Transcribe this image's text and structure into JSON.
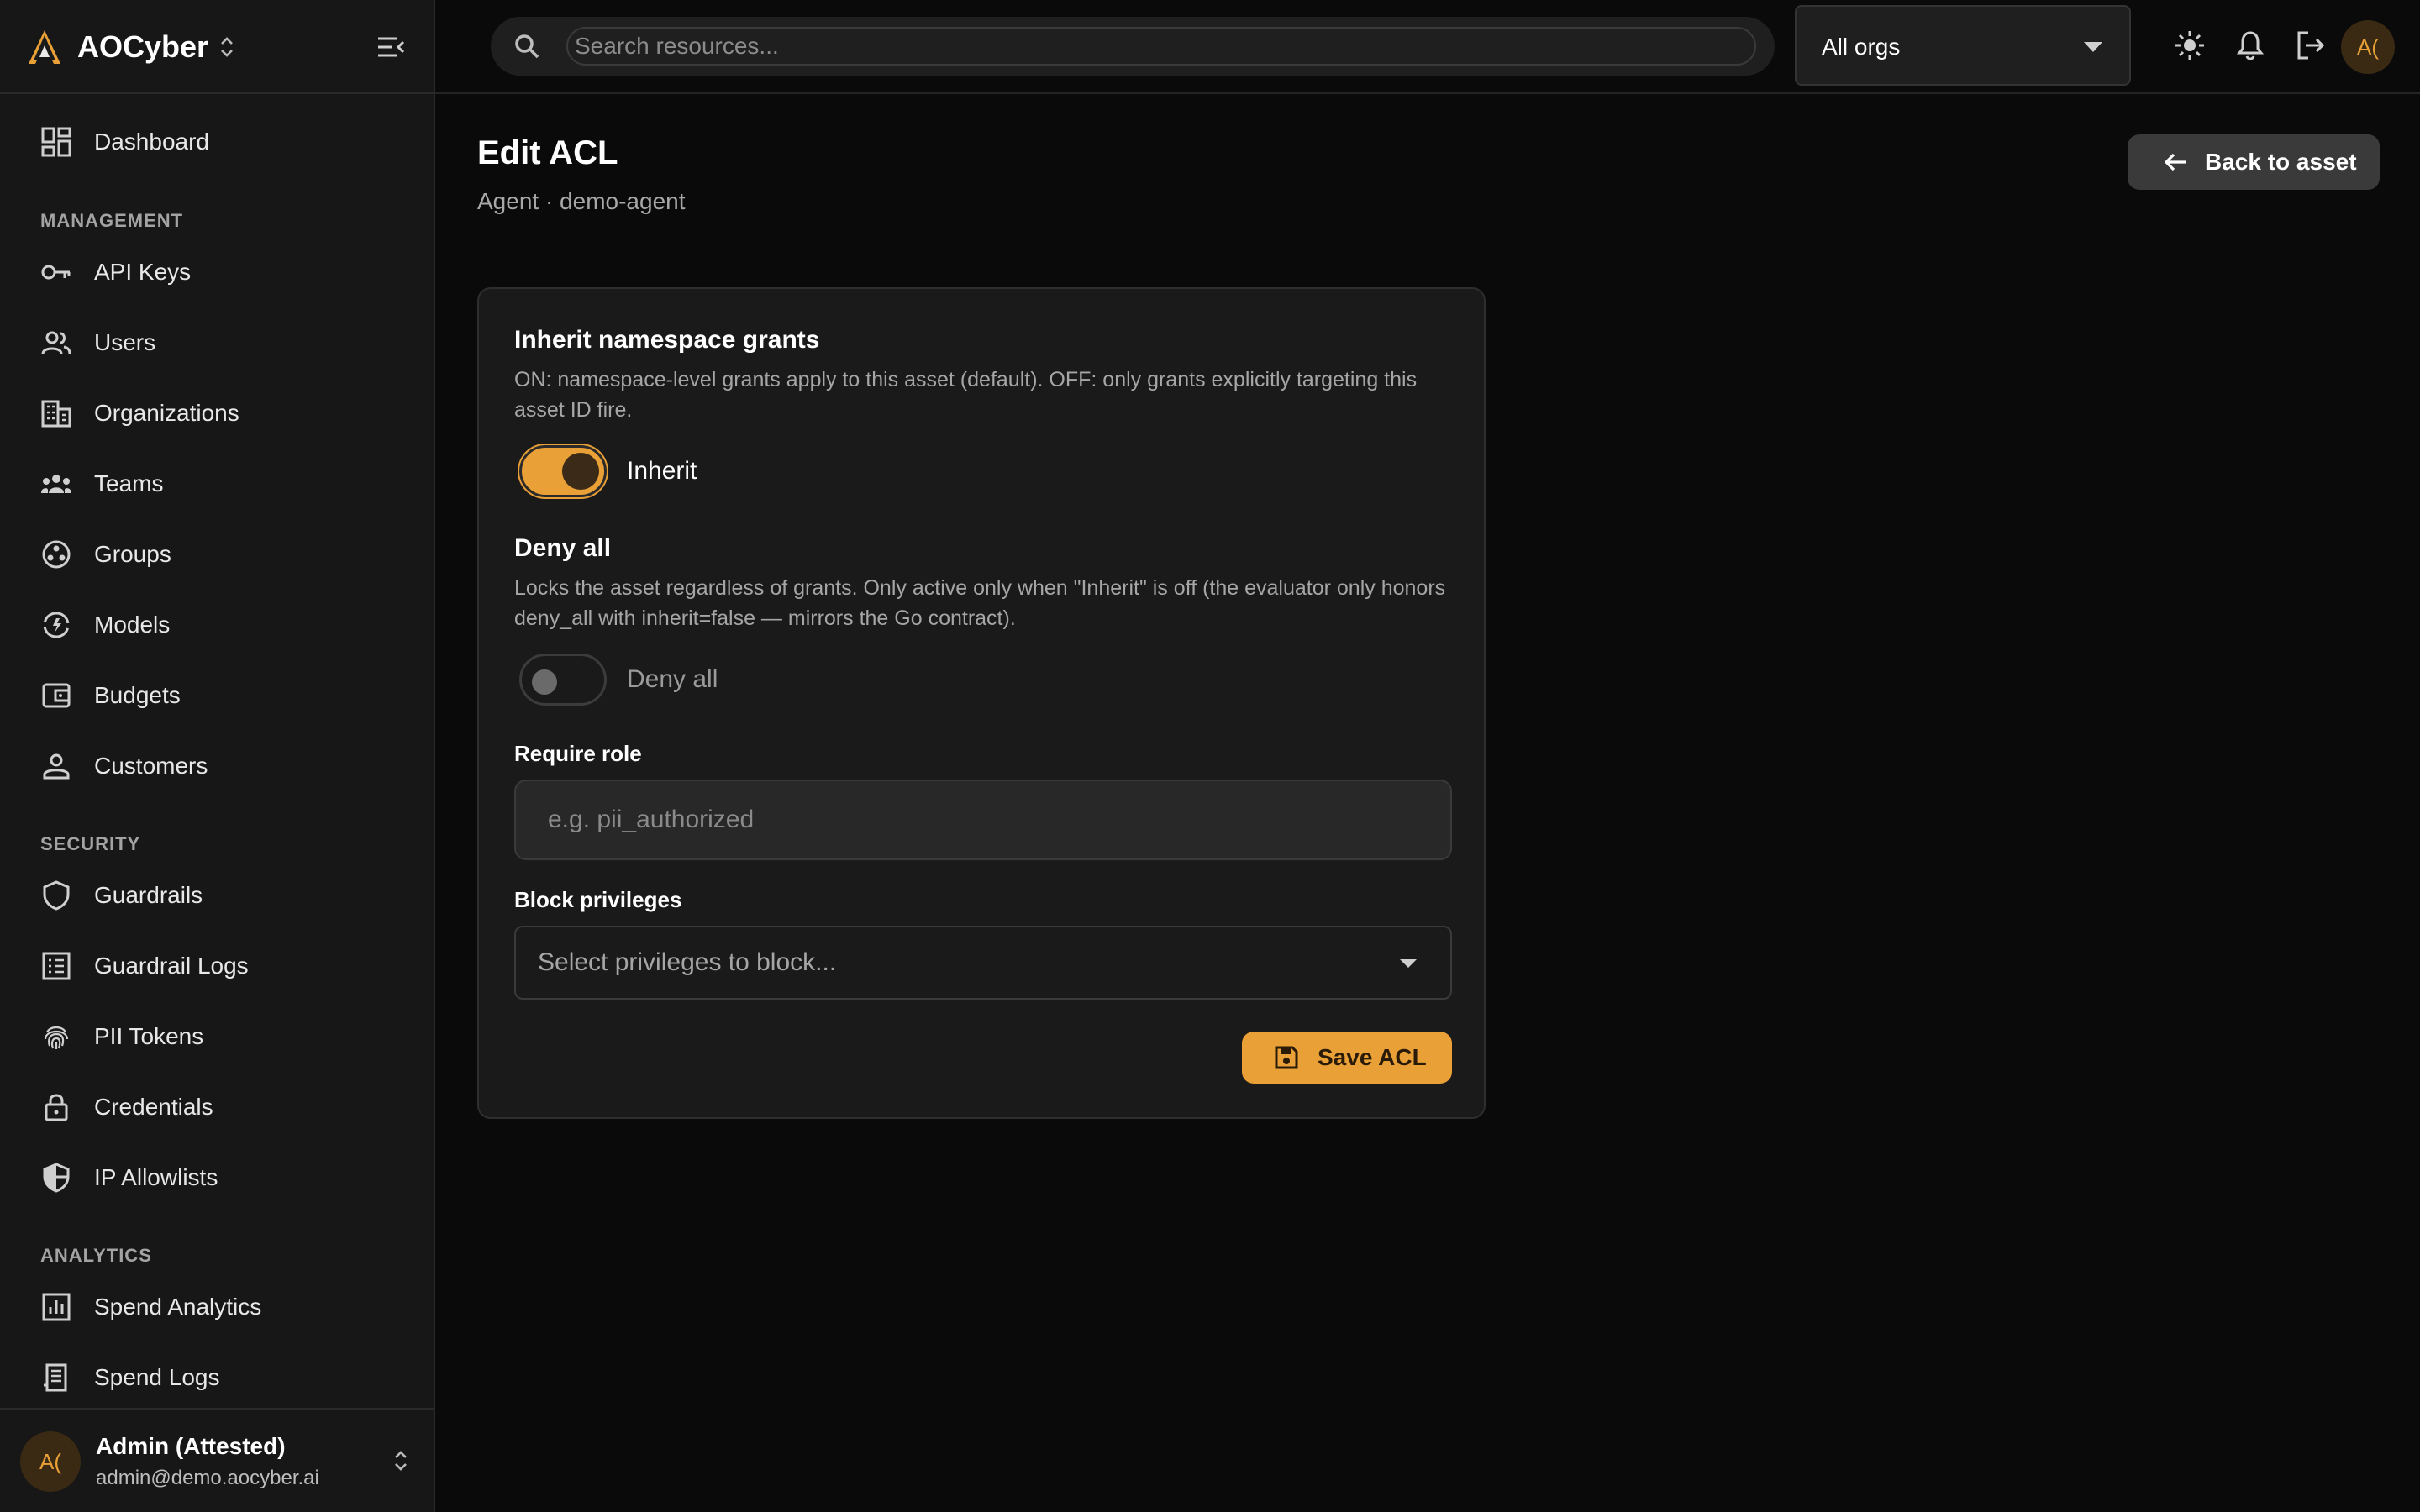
{
  "brand": {
    "name": "AOCyber"
  },
  "sidebar": {
    "top_items": [
      {
        "label": "Dashboard",
        "icon": "dashboard-icon"
      }
    ],
    "sections": [
      {
        "title": "MANAGEMENT",
        "items": [
          {
            "label": "API Keys",
            "icon": "key-icon"
          },
          {
            "label": "Users",
            "icon": "users-icon"
          },
          {
            "label": "Organizations",
            "icon": "building-icon"
          },
          {
            "label": "Teams",
            "icon": "teams-icon"
          },
          {
            "label": "Groups",
            "icon": "groups-icon"
          },
          {
            "label": "Models",
            "icon": "models-icon"
          },
          {
            "label": "Budgets",
            "icon": "wallet-icon"
          },
          {
            "label": "Customers",
            "icon": "person-icon"
          }
        ]
      },
      {
        "title": "SECURITY",
        "items": [
          {
            "label": "Guardrails",
            "icon": "shield-icon"
          },
          {
            "label": "Guardrail Logs",
            "icon": "list-icon"
          },
          {
            "label": "PII Tokens",
            "icon": "fingerprint-icon"
          },
          {
            "label": "Credentials",
            "icon": "lock-icon"
          },
          {
            "label": "IP Allowlists",
            "icon": "shield-half-icon"
          }
        ]
      },
      {
        "title": "ANALYTICS",
        "items": [
          {
            "label": "Spend Analytics",
            "icon": "chart-icon"
          },
          {
            "label": "Spend Logs",
            "icon": "receipt-icon"
          }
        ]
      }
    ],
    "user": {
      "initials": "A(",
      "name": "Admin (Attested)",
      "email": "admin@demo.aocyber.ai"
    }
  },
  "topbar": {
    "search_placeholder": "Search resources...",
    "org_select": "All orgs",
    "avatar_initials": "A("
  },
  "page": {
    "title": "Edit ACL",
    "subtitle": "Agent · demo-agent",
    "back_label": "Back to asset"
  },
  "form": {
    "inherit": {
      "title": "Inherit namespace grants",
      "desc": "ON: namespace-level grants apply to this asset (default). OFF: only grants explicitly targeting this asset ID fire.",
      "toggle_label": "Inherit",
      "on": true
    },
    "deny": {
      "title": "Deny all",
      "desc": "Locks the asset regardless of grants. Only active only when \"Inherit\" is off (the evaluator only honors deny_all with inherit=false — mirrors the Go contract).",
      "toggle_label": "Deny all",
      "on": false
    },
    "require_role": {
      "label": "Require role",
      "placeholder": "e.g. pii_authorized",
      "value": ""
    },
    "block_privileges": {
      "label": "Block privileges",
      "placeholder": "Select privileges to block..."
    },
    "save_label": "Save ACL"
  },
  "colors": {
    "accent": "#e9a037",
    "background": "#0a0a0a",
    "sidebar": "#171717",
    "card": "#1a1a1a"
  }
}
